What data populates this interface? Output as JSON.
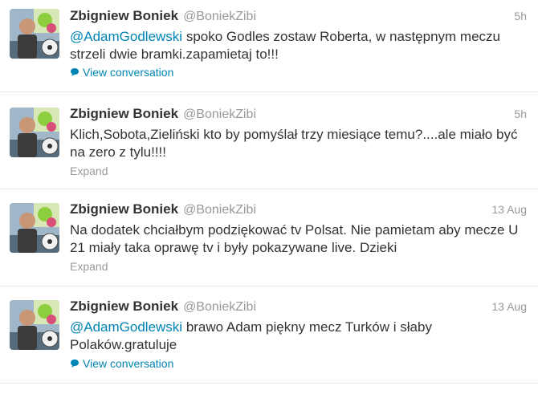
{
  "tweets": [
    {
      "name": "Zbigniew Boniek",
      "handle": "@BoniekZibi",
      "time": "5h",
      "mention": "@AdamGodlewski",
      "text_after_mention": " spoko Godles zostaw Roberta, w następnym meczu strzeli dwie bramki.zapamietaj to!!!",
      "action": "View conversation",
      "action_icon": "speech-bubble-icon"
    },
    {
      "name": "Zbigniew Boniek",
      "handle": "@BoniekZibi",
      "time": "5h",
      "text": "Klich,Sobota,Zieliński kto by pomyślał trzy miesiące temu?....ale miało być na zero z tylu!!!!",
      "action": "Expand"
    },
    {
      "name": "Zbigniew Boniek",
      "handle": "@BoniekZibi",
      "time": "13 Aug",
      "text": "Na dodatek chciałbym podziękować tv Polsat. Nie pamietam aby mecze U 21 miały taka oprawę tv i były pokazywane live. Dzieki",
      "action": "Expand"
    },
    {
      "name": "Zbigniew Boniek",
      "handle": "@BoniekZibi",
      "time": "13 Aug",
      "mention": "@AdamGodlewski",
      "text_after_mention": " brawo Adam piękny mecz Turków i słaby Polaków.gratuluje",
      "action": "View conversation",
      "action_icon": "speech-bubble-icon"
    }
  ],
  "colors": {
    "link": "#0084b4",
    "muted": "#999999",
    "text": "#333333",
    "divider": "#e8e8e8"
  }
}
